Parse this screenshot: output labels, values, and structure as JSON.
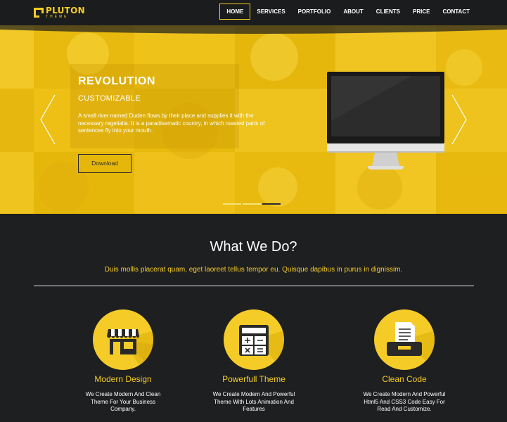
{
  "brand": {
    "name": "PLUTON",
    "tagline": "THEME"
  },
  "nav": {
    "items": [
      {
        "label": "HOME",
        "active": true
      },
      {
        "label": "SERVICES",
        "active": false
      },
      {
        "label": "PORTFOLIO",
        "active": false
      },
      {
        "label": "ABOUT",
        "active": false
      },
      {
        "label": "CLIENTS",
        "active": false
      },
      {
        "label": "PRICE",
        "active": false
      },
      {
        "label": "CONTACT",
        "active": false
      }
    ]
  },
  "hero": {
    "headline": "REVOLUTION",
    "subhead": "CUSTOMIZABLE",
    "text": "A small river named Duden flows by their place and supplies it with the necessary regelialia. It is a paradisematic country, in which roasted parts of sentences fly into your mouth.",
    "button_label": "Download",
    "slides": 3,
    "active_slide": 2,
    "icons": {
      "prev": "chevron-left-icon",
      "next": "chevron-right-icon"
    }
  },
  "services": {
    "title": "What We Do?",
    "subtitle": "Duis mollis placerat quam, eget laoreet tellus tempor eu. Quisque dapibus in purus in dignissim.",
    "features": [
      {
        "icon": "shop-icon",
        "title": "Modern Design",
        "text": "We Create Modern And Clean Theme For Your Business Company."
      },
      {
        "icon": "calculator-icon",
        "title": "Powerfull Theme",
        "text": "We Create Modern And Powerful Theme With Lots Animation And Features"
      },
      {
        "icon": "printer-icon",
        "title": "Clean Code",
        "text": "We Create Modern And Powerful Html5 And CSS3 Code Easy For Read And Customize."
      }
    ]
  },
  "colors": {
    "accent": "#f5cc27",
    "background": "#1e1f21",
    "hero": "#efc315"
  }
}
